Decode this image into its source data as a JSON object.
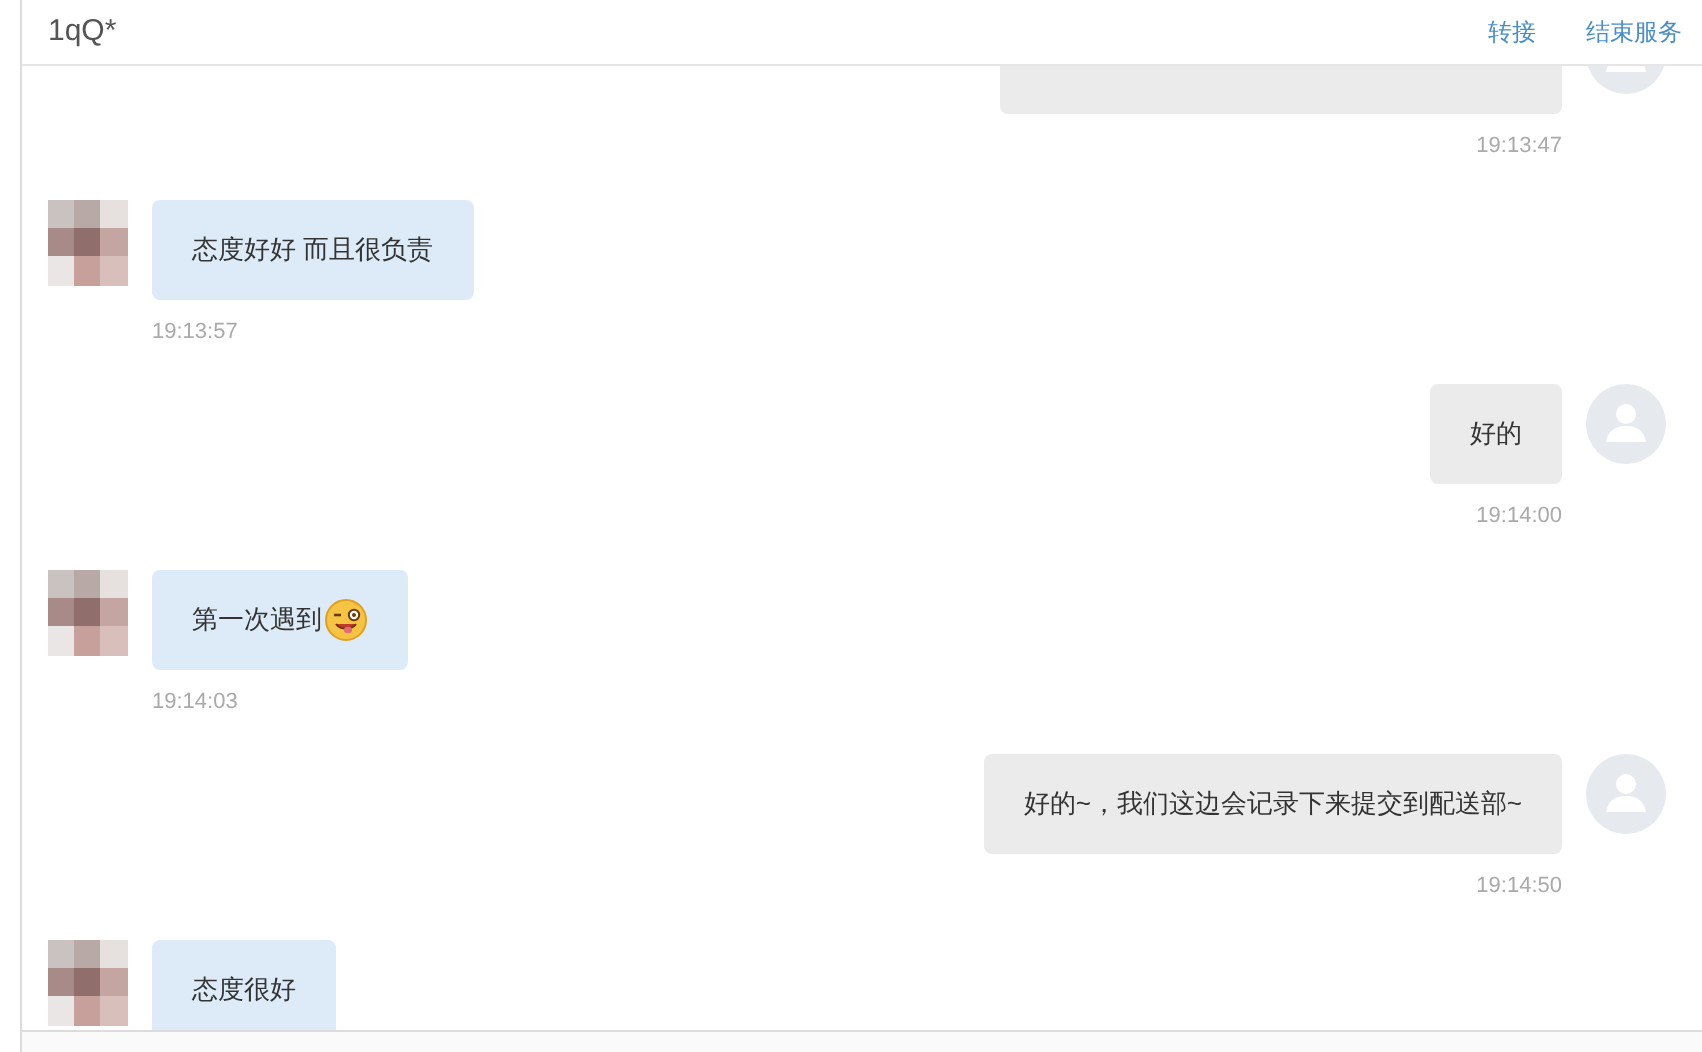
{
  "header": {
    "title": "1qQ*",
    "actions": [
      "转接",
      "结束服务"
    ]
  },
  "messages": [
    {
      "kind": "agent",
      "time": "19:13:47",
      "emoji": false
    },
    {
      "kind": "customer",
      "text": "态度好好 而且很负责",
      "time": "19:13:57",
      "emoji": false
    },
    {
      "kind": "agent",
      "text": "好的",
      "time": "19:14:00",
      "emoji": false
    },
    {
      "kind": "customer",
      "text": "第一次遇到",
      "time": "19:14:03",
      "emoji": true
    },
    {
      "kind": "agent",
      "text": "好的~，我们这边会记录下来提交到配送部~",
      "time": "19:14:50",
      "emoji": false
    },
    {
      "kind": "customer",
      "text": "态度很好",
      "emoji": false
    }
  ]
}
